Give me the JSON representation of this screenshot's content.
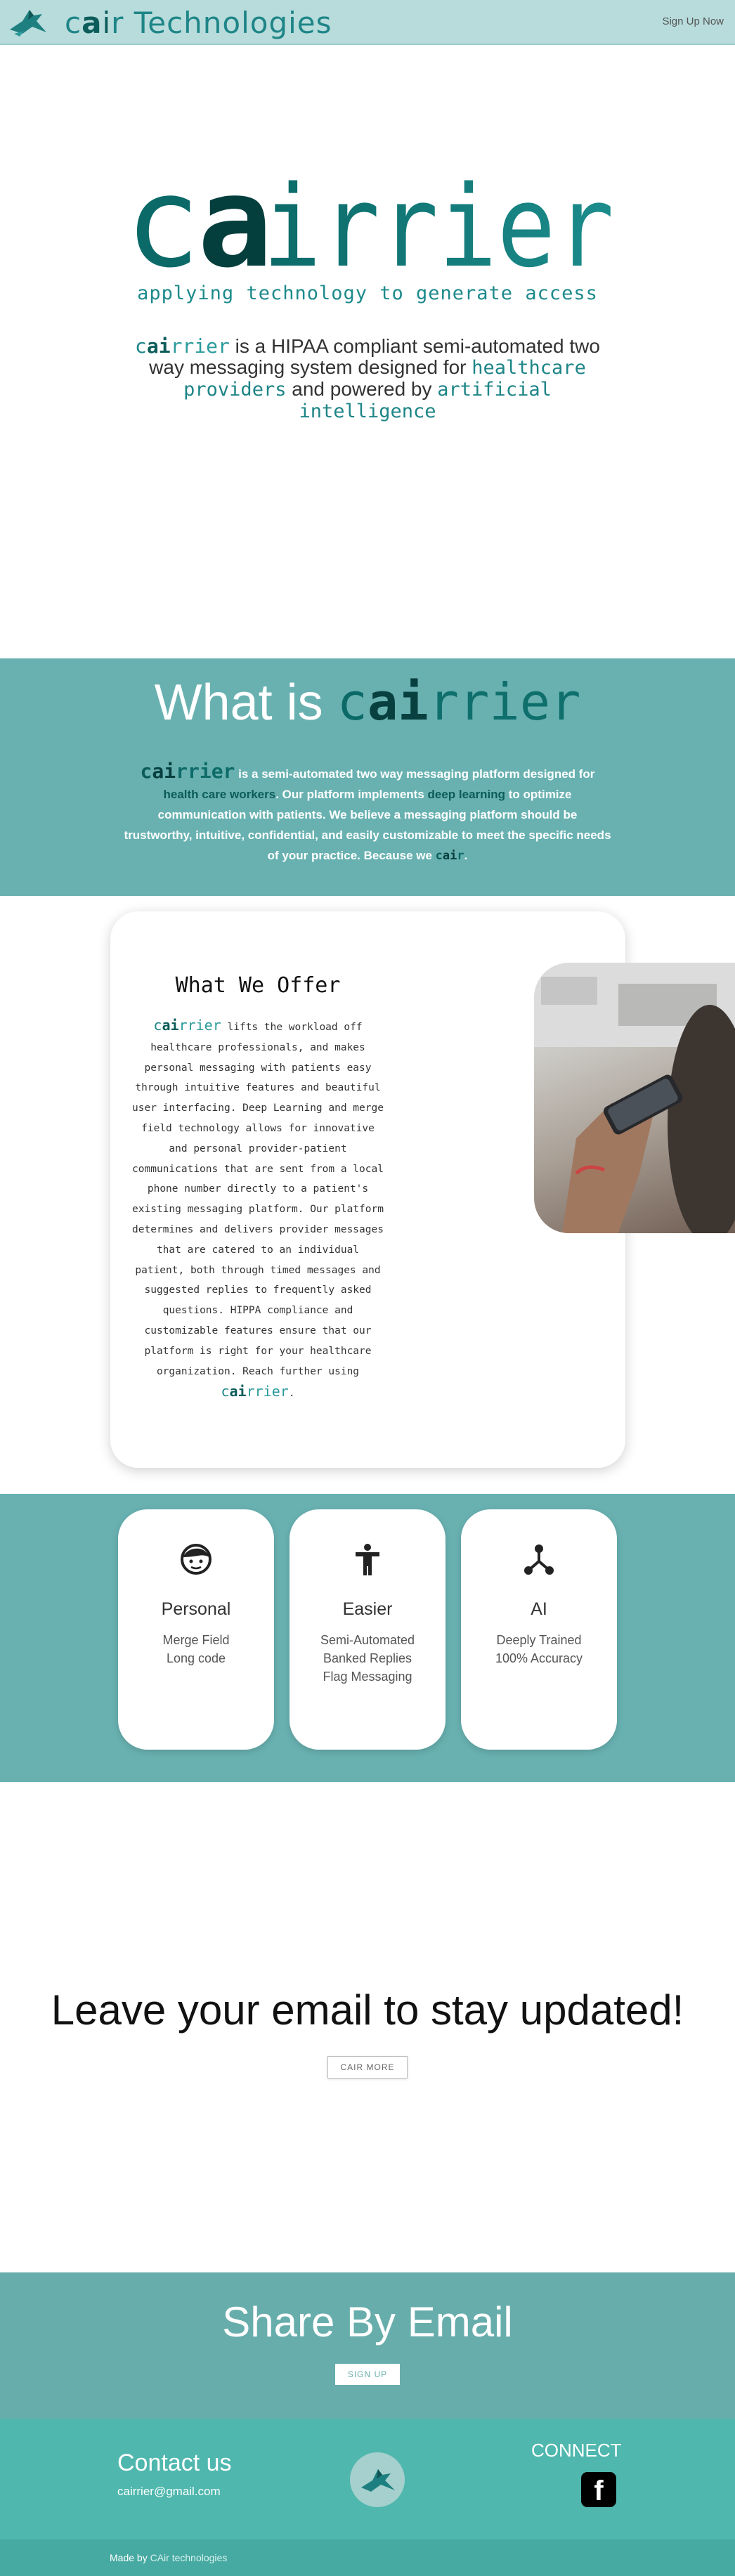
{
  "header": {
    "brand_c": "c",
    "brand_a": "a",
    "brand_i": "i",
    "brand_rest": "r Technologies",
    "signup": "Sign Up Now"
  },
  "hero": {
    "logo_c": "c",
    "logo_a": "a",
    "logo_rest": "irrier",
    "tagline": "applying technology to generate access",
    "desc_cair_c": "c",
    "desc_cair_a": "ai",
    "desc_cair_rest": "rrier",
    "desc_1": " is a HIPAA compliant semi-automated two way messaging system designed for ",
    "desc_hl1": "healthcare providers",
    "desc_2": " and powered by ",
    "desc_hl2": "artificial intelligence"
  },
  "what_is": {
    "title_prefix": "What is ",
    "title_c": "c",
    "title_a": "ai",
    "title_rest": "rrier",
    "cair_c": "c",
    "cair_a": "ai",
    "cair_rest": "rrier",
    "text_1": " is a semi-automated two way messaging platform designed for ",
    "hl_1": "health care workers",
    "text_2": ". Our platform implements ",
    "hl_2": "deep learning",
    "text_3": " to optimize communication with patients. We believe a messaging platform should be trustworthy, intuitive, confidential, and easily customizable to meet the specific needs of your practice. Because we ",
    "end_c": "c",
    "end_a": "ai",
    "end_r": "r",
    "end_dot": "."
  },
  "offer": {
    "title": "What We Offer",
    "cair_c": "c",
    "cair_a": "ai",
    "cair_rest": "rrier",
    "body": " lifts the workload off healthcare professionals, and makes personal messaging with patients easy through intuitive features and beautiful user interfacing. Deep Learning and merge field technology allows for innovative and personal provider-patient communications that are sent from a local phone number directly to a patient's existing messaging platform. Our platform determines and delivers provider messages that are catered to an individual patient, both through timed messages and suggested replies to frequently asked questions. HIPPA compliance and customizable features ensure that our platform is right for your healthcare organization. Reach further using ",
    "end_c": "c",
    "end_a": "ai",
    "end_rest": "rrier",
    "end_dot": "."
  },
  "features": [
    {
      "icon": "face-icon",
      "title": "Personal",
      "lines": [
        "Merge Field",
        "Long code"
      ]
    },
    {
      "icon": "person-icon",
      "title": "Easier",
      "lines": [
        "Semi-Automated",
        "Banked Replies",
        "Flag Messaging"
      ]
    },
    {
      "icon": "network-icon",
      "title": "AI",
      "lines": [
        "Deeply Trained",
        "100% Accuracy"
      ]
    }
  ],
  "email_section": {
    "title": "Leave your email to stay updated!",
    "button": "CAIR MORE"
  },
  "share": {
    "title": "Share By Email",
    "button": "SIGN UP"
  },
  "footer": {
    "contact_title": "Contact us",
    "contact_email": "cairrier@gmail.com",
    "connect": "CONNECT",
    "facebook": "f",
    "made_by": "Made by ",
    "made_link": "CAir technologies"
  },
  "colors": {
    "header_bg": "#b8dcdc",
    "teal": "#1e8587",
    "dark_teal": "#0b5c5a",
    "section_teal": "#69b1b1",
    "footer_teal": "#4fb7ae"
  }
}
